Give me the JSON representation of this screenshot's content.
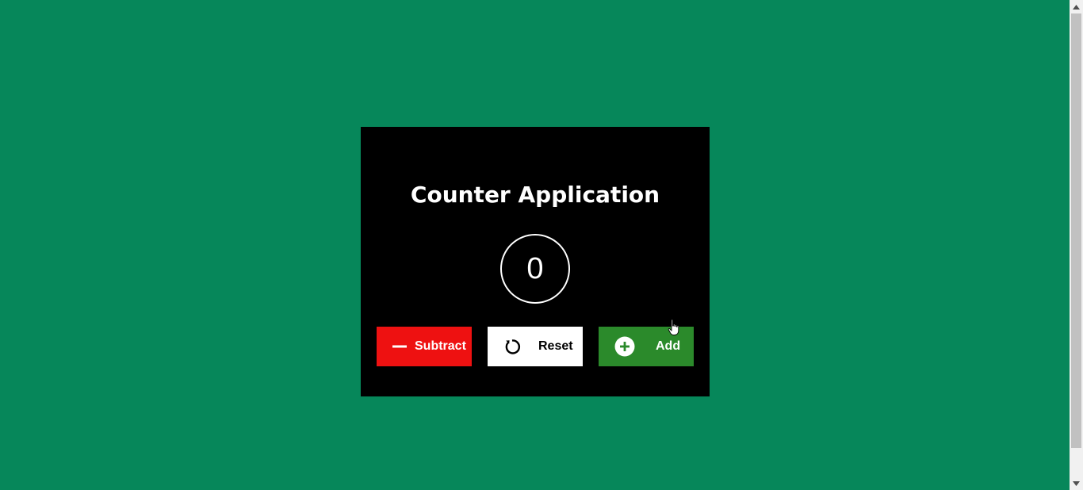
{
  "app": {
    "title": "Counter Application",
    "count": "0"
  },
  "buttons": {
    "subtract": {
      "label": "Subtract",
      "icon": "minus-icon",
      "color": "#ee1111"
    },
    "reset": {
      "label": "Reset",
      "icon": "refresh-icon",
      "color": "#ffffff"
    },
    "add": {
      "label": "Add",
      "icon": "plus-circle-icon",
      "color": "#2b8a2b"
    }
  },
  "colors": {
    "background": "#06875a",
    "card": "#000000"
  }
}
